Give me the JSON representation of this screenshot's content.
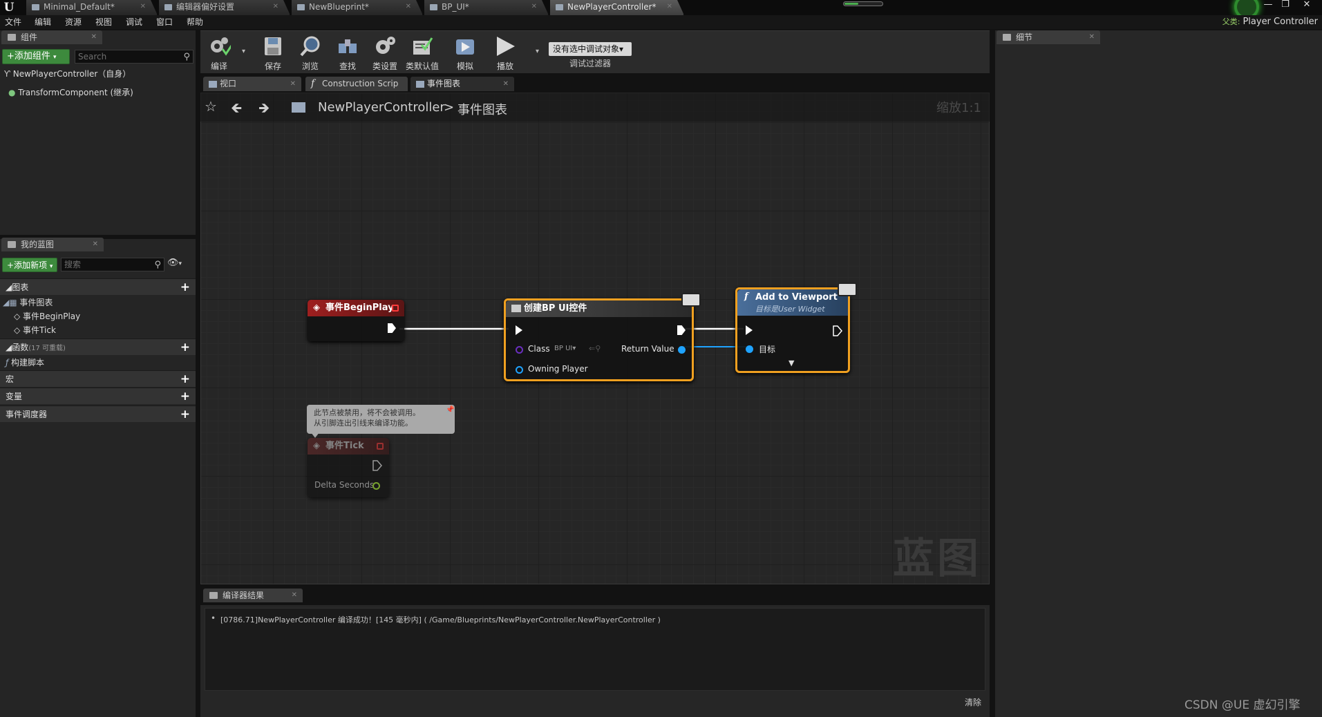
{
  "titlebar": {
    "logo": "U",
    "tabs": [
      {
        "label": "Minimal_Default*"
      },
      {
        "label": "编辑器偏好设置"
      },
      {
        "label": "NewBlueprint*"
      },
      {
        "label": "BP_UI*"
      },
      {
        "label": "NewPlayerController*"
      }
    ],
    "minimize": "—",
    "maximize": "❐",
    "close": "✕"
  },
  "menubar": {
    "items": [
      "文件",
      "编辑",
      "资源",
      "视图",
      "调试",
      "窗口",
      "帮助"
    ],
    "parent_class_label": "父类:",
    "parent_class_value": "Player Controller"
  },
  "components_panel": {
    "tab": "组件",
    "add_button": "+添加组件",
    "search_placeholder": "Search",
    "items": [
      "NewPlayerController（自身）",
      "TransformComponent (继承)"
    ]
  },
  "myblueprint_panel": {
    "tab": "我的蓝图",
    "add_button": "+添加新项",
    "search_placeholder": "搜索",
    "sections": {
      "graphs": "图表",
      "event_graph": "事件图表",
      "event_beginplay": "事件BeginPlay",
      "event_tick": "事件Tick",
      "functions": "函数",
      "functions_note": "(17 可重载)",
      "construction_script": "构建脚本",
      "macros": "宏",
      "variables": "变量",
      "event_dispatchers": "事件调度器"
    }
  },
  "toolbar": {
    "buttons": [
      "编译",
      "保存",
      "浏览",
      "查找",
      "类设置",
      "类默认值",
      "模拟",
      "播放"
    ],
    "debug_select": "没有选中调试对象▾",
    "debug_filter": "调试过滤器"
  },
  "graph_tabs": [
    "视口",
    "Construction Scrip",
    "事件图表"
  ],
  "graph": {
    "breadcrumb_root": "NewPlayerController",
    "breadcrumb_sep": ">",
    "breadcrumb_current": "事件图表",
    "zoom": "缩放1:1",
    "watermark": "蓝图",
    "nodes": {
      "beginplay": {
        "title": "事件BeginPlay"
      },
      "create_widget": {
        "title": "创建BP UI控件",
        "class_label": "Class",
        "class_value": "BP UI▾",
        "return_label": "Return Value",
        "owning_player": "Owning Player"
      },
      "add_to_viewport": {
        "title": "Add to Viewport",
        "subtitle": "目标是User Widget",
        "target_label": "目标"
      },
      "tick": {
        "title": "事件Tick",
        "delta_seconds": "Delta Seconds",
        "disabled_comment": "此节点被禁用，将不会被调用。\n从引脚连出引线来编译功能。"
      }
    }
  },
  "compiler_results": {
    "tab": "编译器结果",
    "log": "[0786.71]NewPlayerController 编译成功！[145 毫秒内] ( /Game/Blueprints/NewPlayerController.NewPlayerController )",
    "clear_button": "清除"
  },
  "details_panel": {
    "tab": "细节"
  },
  "watermark": "CSDN @UE 虚幻引擎",
  "colors": {
    "event_red": "#8b1a1a",
    "function_blue": "#3a5f8a",
    "selection_orange": "#f0a020",
    "object_pin_blue": "#1fa3ff",
    "class_pin_purple": "#6a2fbf",
    "float_pin_green": "#9bd832"
  }
}
